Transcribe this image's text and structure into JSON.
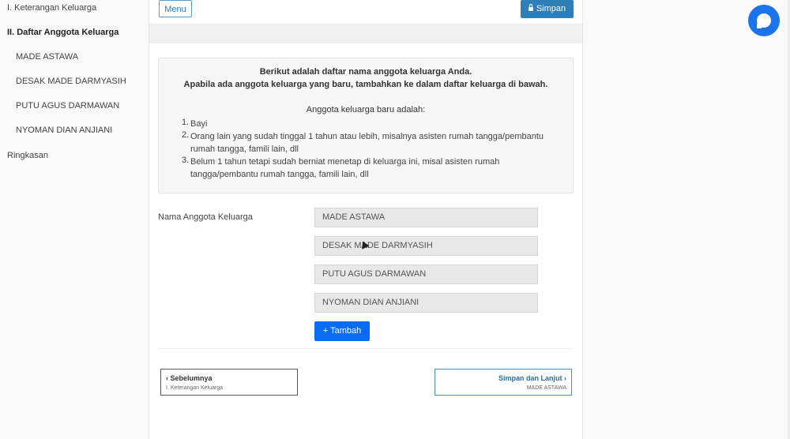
{
  "sidebar": {
    "items": [
      {
        "label": "I. Keterangan Keluarga"
      },
      {
        "label": "II. Daftar Anggota Keluarga"
      },
      {
        "label": "MADE ASTAWA"
      },
      {
        "label": "DESAK MADE DARMYASIH"
      },
      {
        "label": "PUTU AGUS DARMAWAN"
      },
      {
        "label": "NYOMAN DIAN ANJIANI"
      },
      {
        "label": "Ringkasan"
      }
    ]
  },
  "toolbar": {
    "menu_label": "Menu",
    "save_label": "Simpan"
  },
  "info": {
    "line1": "Berikut adalah daftar nama anggota keluarga Anda.",
    "line2": "Apabila ada anggota keluarga yang baru, tambahkan ke dalam daftar keluarga di bawah.",
    "subtitle": "Anggota keluarga baru adalah:",
    "list": [
      {
        "num": "1.",
        "text": "Bayi"
      },
      {
        "num": "2.",
        "text": "Orang lain yang sudah tinggal 1 tahun atau lebih, misalnya asisten rumah tangga/pembantu rumah tangga, famili lain, dll"
      },
      {
        "num": "3.",
        "text": "Belum 1 tahun tetapi sudah berniat menetap di keluarga ini, misal asisten rumah tangga/pembantu rumah tangga, famili lain, dll"
      }
    ]
  },
  "form": {
    "label": "Nama Anggota Keluarga",
    "fields": [
      {
        "value": "MADE ASTAWA"
      },
      {
        "value": "DESAK MADE DARMYASIH"
      },
      {
        "value": "PUTU AGUS DARMAWAN"
      },
      {
        "value": "NYOMAN DIAN ANJIANI"
      }
    ],
    "add_label": "Tambah",
    "add_icon": "plus-icon"
  },
  "nav": {
    "prev_title": "‹ Sebelumnya",
    "prev_sub": "I. Keterangan Keluarga",
    "next_title": "Simpan dan Lanjut ›",
    "next_sub": "MADE ASTAWA"
  },
  "colors": {
    "accent": "#2c7fb8",
    "add_button": "#0a6cf0",
    "chat": "#1a73e8"
  }
}
